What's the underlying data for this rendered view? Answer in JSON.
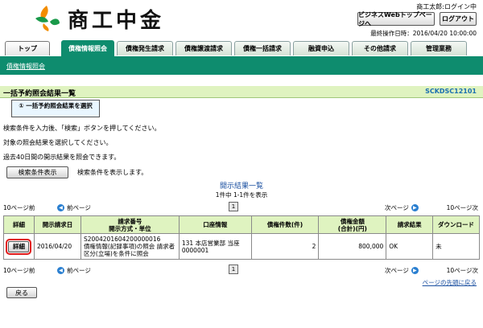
{
  "header": {
    "logo_text": "商工中金",
    "user_name": "商工太郎:ログイン中",
    "webtop_button": "ビジネスWebトップページへ",
    "logout_button": "ログアウト",
    "last_operation": "最終操作日時：2016/04/20 10:00:00"
  },
  "tabs": [
    {
      "label": "トップ"
    },
    {
      "label": "債権情報照会"
    },
    {
      "label": "債権発生請求"
    },
    {
      "label": "債権譲渡請求"
    },
    {
      "label": "債権一括請求"
    },
    {
      "label": "融資申込"
    },
    {
      "label": "その他請求"
    },
    {
      "label": "管理業務"
    }
  ],
  "sublink": "債権情報照会",
  "page": {
    "title": "一括予約照会結果一覧",
    "screen_id": "SCKDSC12101",
    "step_label": "① 一括予約照会結果を選択",
    "instructions": [
      "検索条件を入力後、「検索」ボタンを押してください。",
      "対象の照会結果を選択してください。",
      "過去40日間の開示結果を照会できます。"
    ],
    "search_cond_button": "検索条件表示",
    "search_cond_note": "検索条件を表示します。"
  },
  "list": {
    "title": "開示結果一覧",
    "count": "1件中 1-1件を表示",
    "pager": {
      "prev_size": "10ページ前",
      "prev": "前ページ",
      "current_page": "1",
      "next": "次ページ",
      "next_size": "10ページ次"
    },
    "columns": [
      "詳細",
      "開示請求日",
      "請求番号\n開示方式・単位",
      "口座情報",
      "債権件数(件)",
      "債権金額\n(合計)(円)",
      "請求結果",
      "ダウンロード"
    ],
    "rows": [
      {
        "detail_button": "詳細",
        "date": "2016/04/20",
        "request_line1": "S2004201604200000016",
        "request_line2": "債権情報(記録事項)の照会 請求者区分(立場)を条件に照会",
        "account": "131 本店営業部 当座 0000001",
        "count": "2",
        "amount": "800,000",
        "result": "OK",
        "download": "未"
      }
    ]
  },
  "footer": {
    "page_top_link": "ページの先頭に戻る",
    "back_button": "戻る"
  }
}
